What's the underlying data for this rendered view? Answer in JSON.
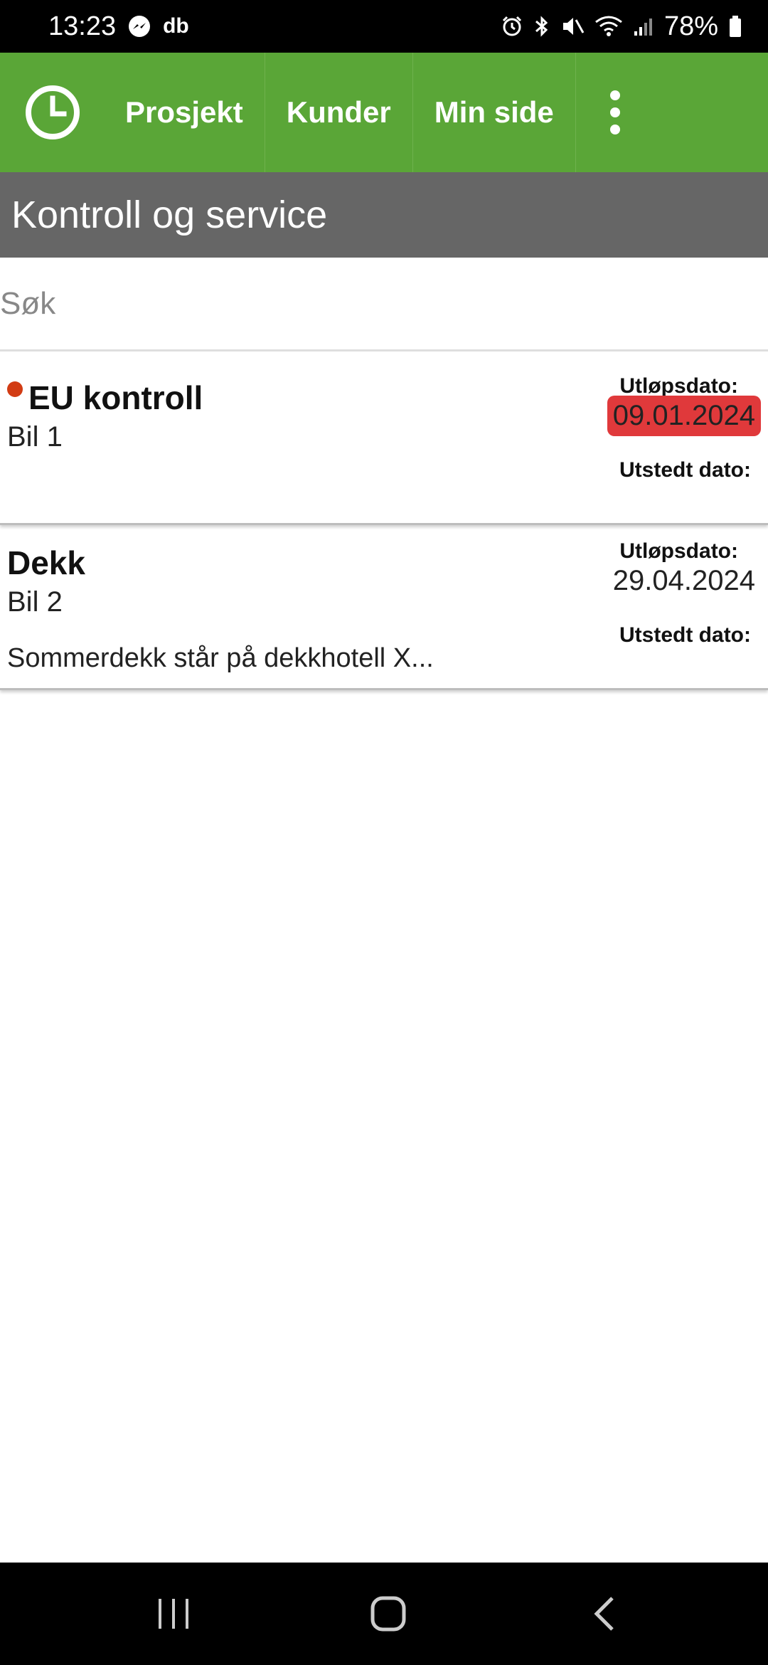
{
  "status_bar": {
    "time": "13:23",
    "notification_text": "db",
    "battery_percent": "78%",
    "icons": [
      "messenger-icon",
      "alarm-icon",
      "bluetooth-icon",
      "mute-icon",
      "wifi-icon",
      "signal-icon",
      "battery-icon"
    ]
  },
  "toolbar": {
    "background_color": "#5aa637",
    "items": [
      {
        "label": "Prosjekt"
      },
      {
        "label": "Kunder"
      },
      {
        "label": "Min side"
      }
    ]
  },
  "page": {
    "title": "Kontroll og service"
  },
  "search": {
    "placeholder": "Søk",
    "value": ""
  },
  "cards": [
    {
      "title": "EU kontroll",
      "subtitle": "Bil 1",
      "note": "",
      "expiry_label": "Utløpsdato:",
      "expiry_date": "09.01.2024",
      "issued_label": "Utstedt dato:",
      "overdue": true
    },
    {
      "title": "Dekk",
      "subtitle": "Bil 2",
      "note": "Sommerdekk står på dekkhotell X...",
      "expiry_label": "Utløpsdato:",
      "expiry_date": "29.04.2024",
      "issued_label": "Utstedt dato:",
      "overdue": false
    }
  ],
  "colors": {
    "overdue": "#e0393b",
    "indicator_dot": "#d23c14",
    "title_bar": "#666666"
  }
}
